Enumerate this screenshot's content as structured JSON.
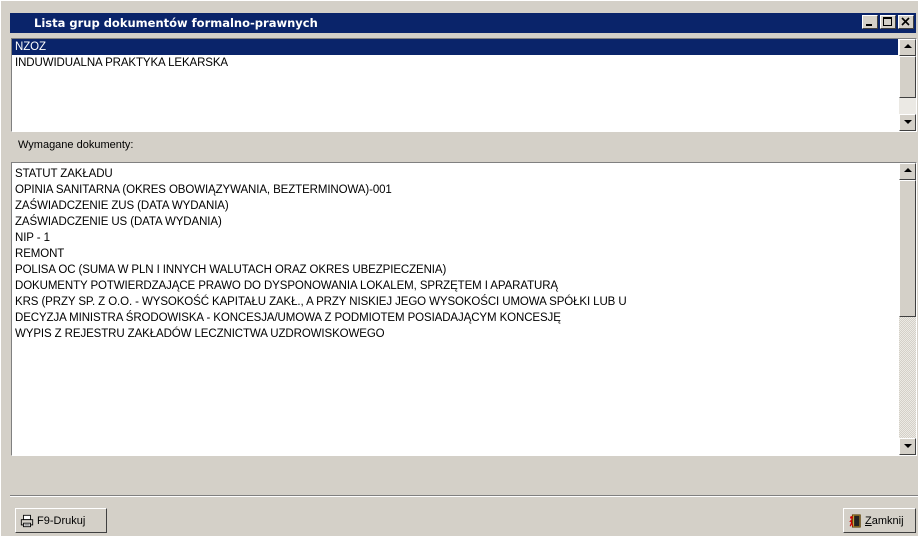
{
  "window": {
    "title": "Lista grup dokumentów formalno-prawnych",
    "controls": {
      "minimize": "_",
      "maximize": "□",
      "close": "×"
    }
  },
  "groups": {
    "items": [
      {
        "label": "NZOZ",
        "selected": true
      },
      {
        "label": "INDUWIDUALNA PRAKTYKA LEKARSKA",
        "selected": false
      }
    ]
  },
  "required_docs": {
    "label": "Wymagane dokumenty:",
    "items": [
      "STATUT ZAKŁADU",
      "OPINIA SANITARNA (OKRES OBOWIĄZYWANIA, BEZTERMINOWA)-001",
      "ZAŚWIADCZENIE ZUS  (DATA WYDANIA)",
      "ZAŚWIADCZENIE US  (DATA WYDANIA)",
      "NIP - 1",
      "REMONT",
      "POLISA OC  (SUMA W PLN I INNYCH WALUTACH ORAZ OKRES UBEZPIECZENIA)",
      "DOKUMENTY POTWIERDZAJĄCE PRAWO DO DYSPONOWANIA LOKALEM, SPRZĘTEM I APARATURĄ",
      "KRS (PRZY SP. Z O.O. - WYSOKOŚĆ KAPITAŁU ZAKŁ., A PRZY NISKIEJ JEGO WYSOKOŚCI UMOWA SPÓŁKI LUB U",
      "DECYZJA MINISTRA ŚRODOWISKA - KONCESJA/UMOWA Z PODMIOTEM POSIADAJĄCYM KONCESJĘ",
      "WYPIS Z REJESTRU ZAKŁADÓW LECZNICTWA UZDROWISKOWEGO"
    ]
  },
  "buttons": {
    "print": {
      "label": "F9-Drukuj",
      "icon": "printer-icon"
    },
    "close": {
      "mnemonic": "Z",
      "rest": "amknij",
      "icon": "door-exit-icon"
    }
  }
}
